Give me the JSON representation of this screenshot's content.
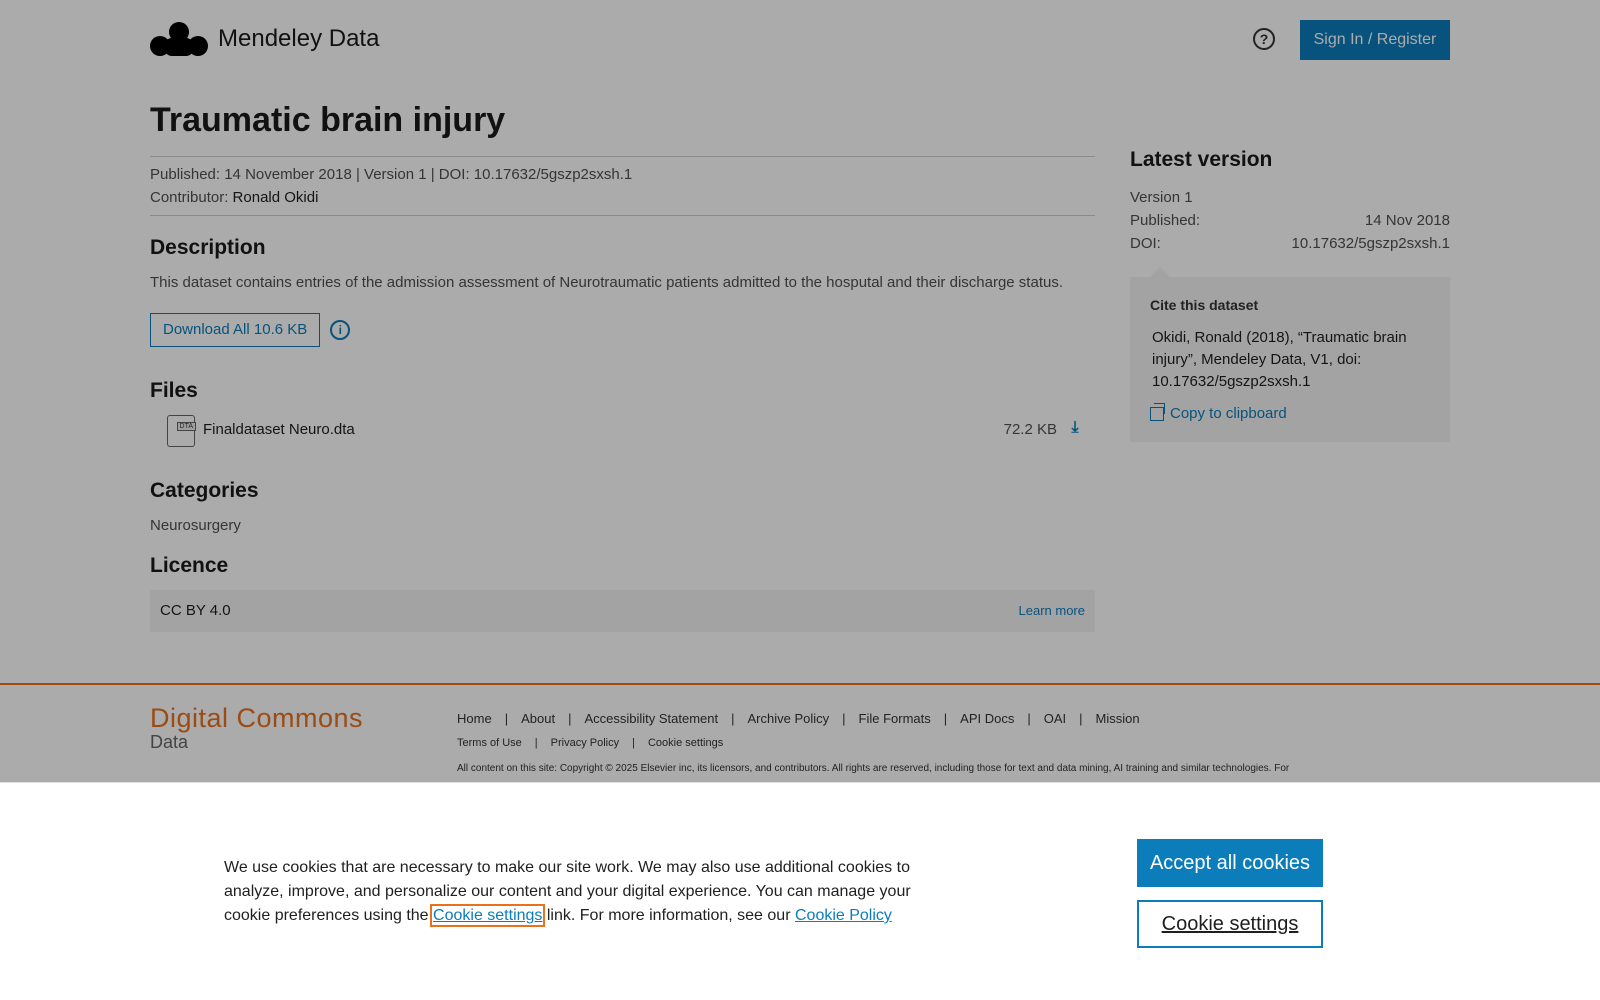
{
  "header": {
    "brand": "Mendeley Data",
    "help_icon": "question-circle-icon",
    "signin_label": "Sign In / Register"
  },
  "dataset": {
    "title": "Traumatic brain injury",
    "meta_line": "Published: 14 November 2018 | Version 1 | DOI: 10.17632/5gszp2sxsh.1",
    "contributor_label": "Contributor:",
    "contributor_name": "Ronald Okidi",
    "description_heading": "Description",
    "description": "This dataset contains entries of the admission assessment of Neurotraumatic patients admitted to the hosputal and their discharge status.",
    "download_all_label": "Download All 10.6 KB",
    "files_heading": "Files",
    "files": [
      {
        "name": "Finaldataset Neuro.dta",
        "type_tag": "DTA",
        "size": "72.2 KB"
      }
    ],
    "categories_heading": "Categories",
    "categories": [
      "Neurosurgery"
    ],
    "licence_heading": "Licence",
    "licence_name": "CC BY 4.0",
    "licence_link": "Learn more"
  },
  "sidebar": {
    "heading": "Latest version",
    "version": "Version 1",
    "published_label": "Published:",
    "published_value": "14 Nov 2018",
    "doi_label": "DOI:",
    "doi_value": "10.17632/5gszp2sxsh.1",
    "cite_title": "Cite this dataset",
    "cite_text": "Okidi, Ronald (2018), “Traumatic brain injury”, Mendeley Data, V1, doi: 10.17632/5gszp2sxsh.1",
    "copy_label": "Copy to clipboard"
  },
  "footer": {
    "logo_line1": "Digital Commons",
    "logo_line2": "Data",
    "links": [
      "Home",
      "About",
      "Accessibility Statement",
      "Archive Policy",
      "File Formats",
      "API Docs",
      "OAI",
      "Mission"
    ],
    "links2": [
      "Terms of Use",
      "Privacy Policy",
      "Cookie settings"
    ],
    "copyright": "All content on this site: Copyright © 2025 Elsevier inc, its licensors, and contributors. All rights are reserved, including those for text and data mining, AI training and similar technologies. For"
  },
  "cookie_banner": {
    "text_before": "We use cookies that are necessary to make our site work. We may also use additional cookies to analyze, improve, and personalize our content and your digital experience. You can manage your cookie preferences using the",
    "settings_link": "Cookie settings",
    "text_middle": "link. For more information, see our",
    "policy_link": "Cookie Policy",
    "accept_label": "Accept all cookies",
    "settings_label": "Cookie settings"
  },
  "colors": {
    "accent": "#0c7dbb",
    "brand_orange": "#e9711c",
    "overlay": "rgba(0,0,0,0.33)"
  }
}
